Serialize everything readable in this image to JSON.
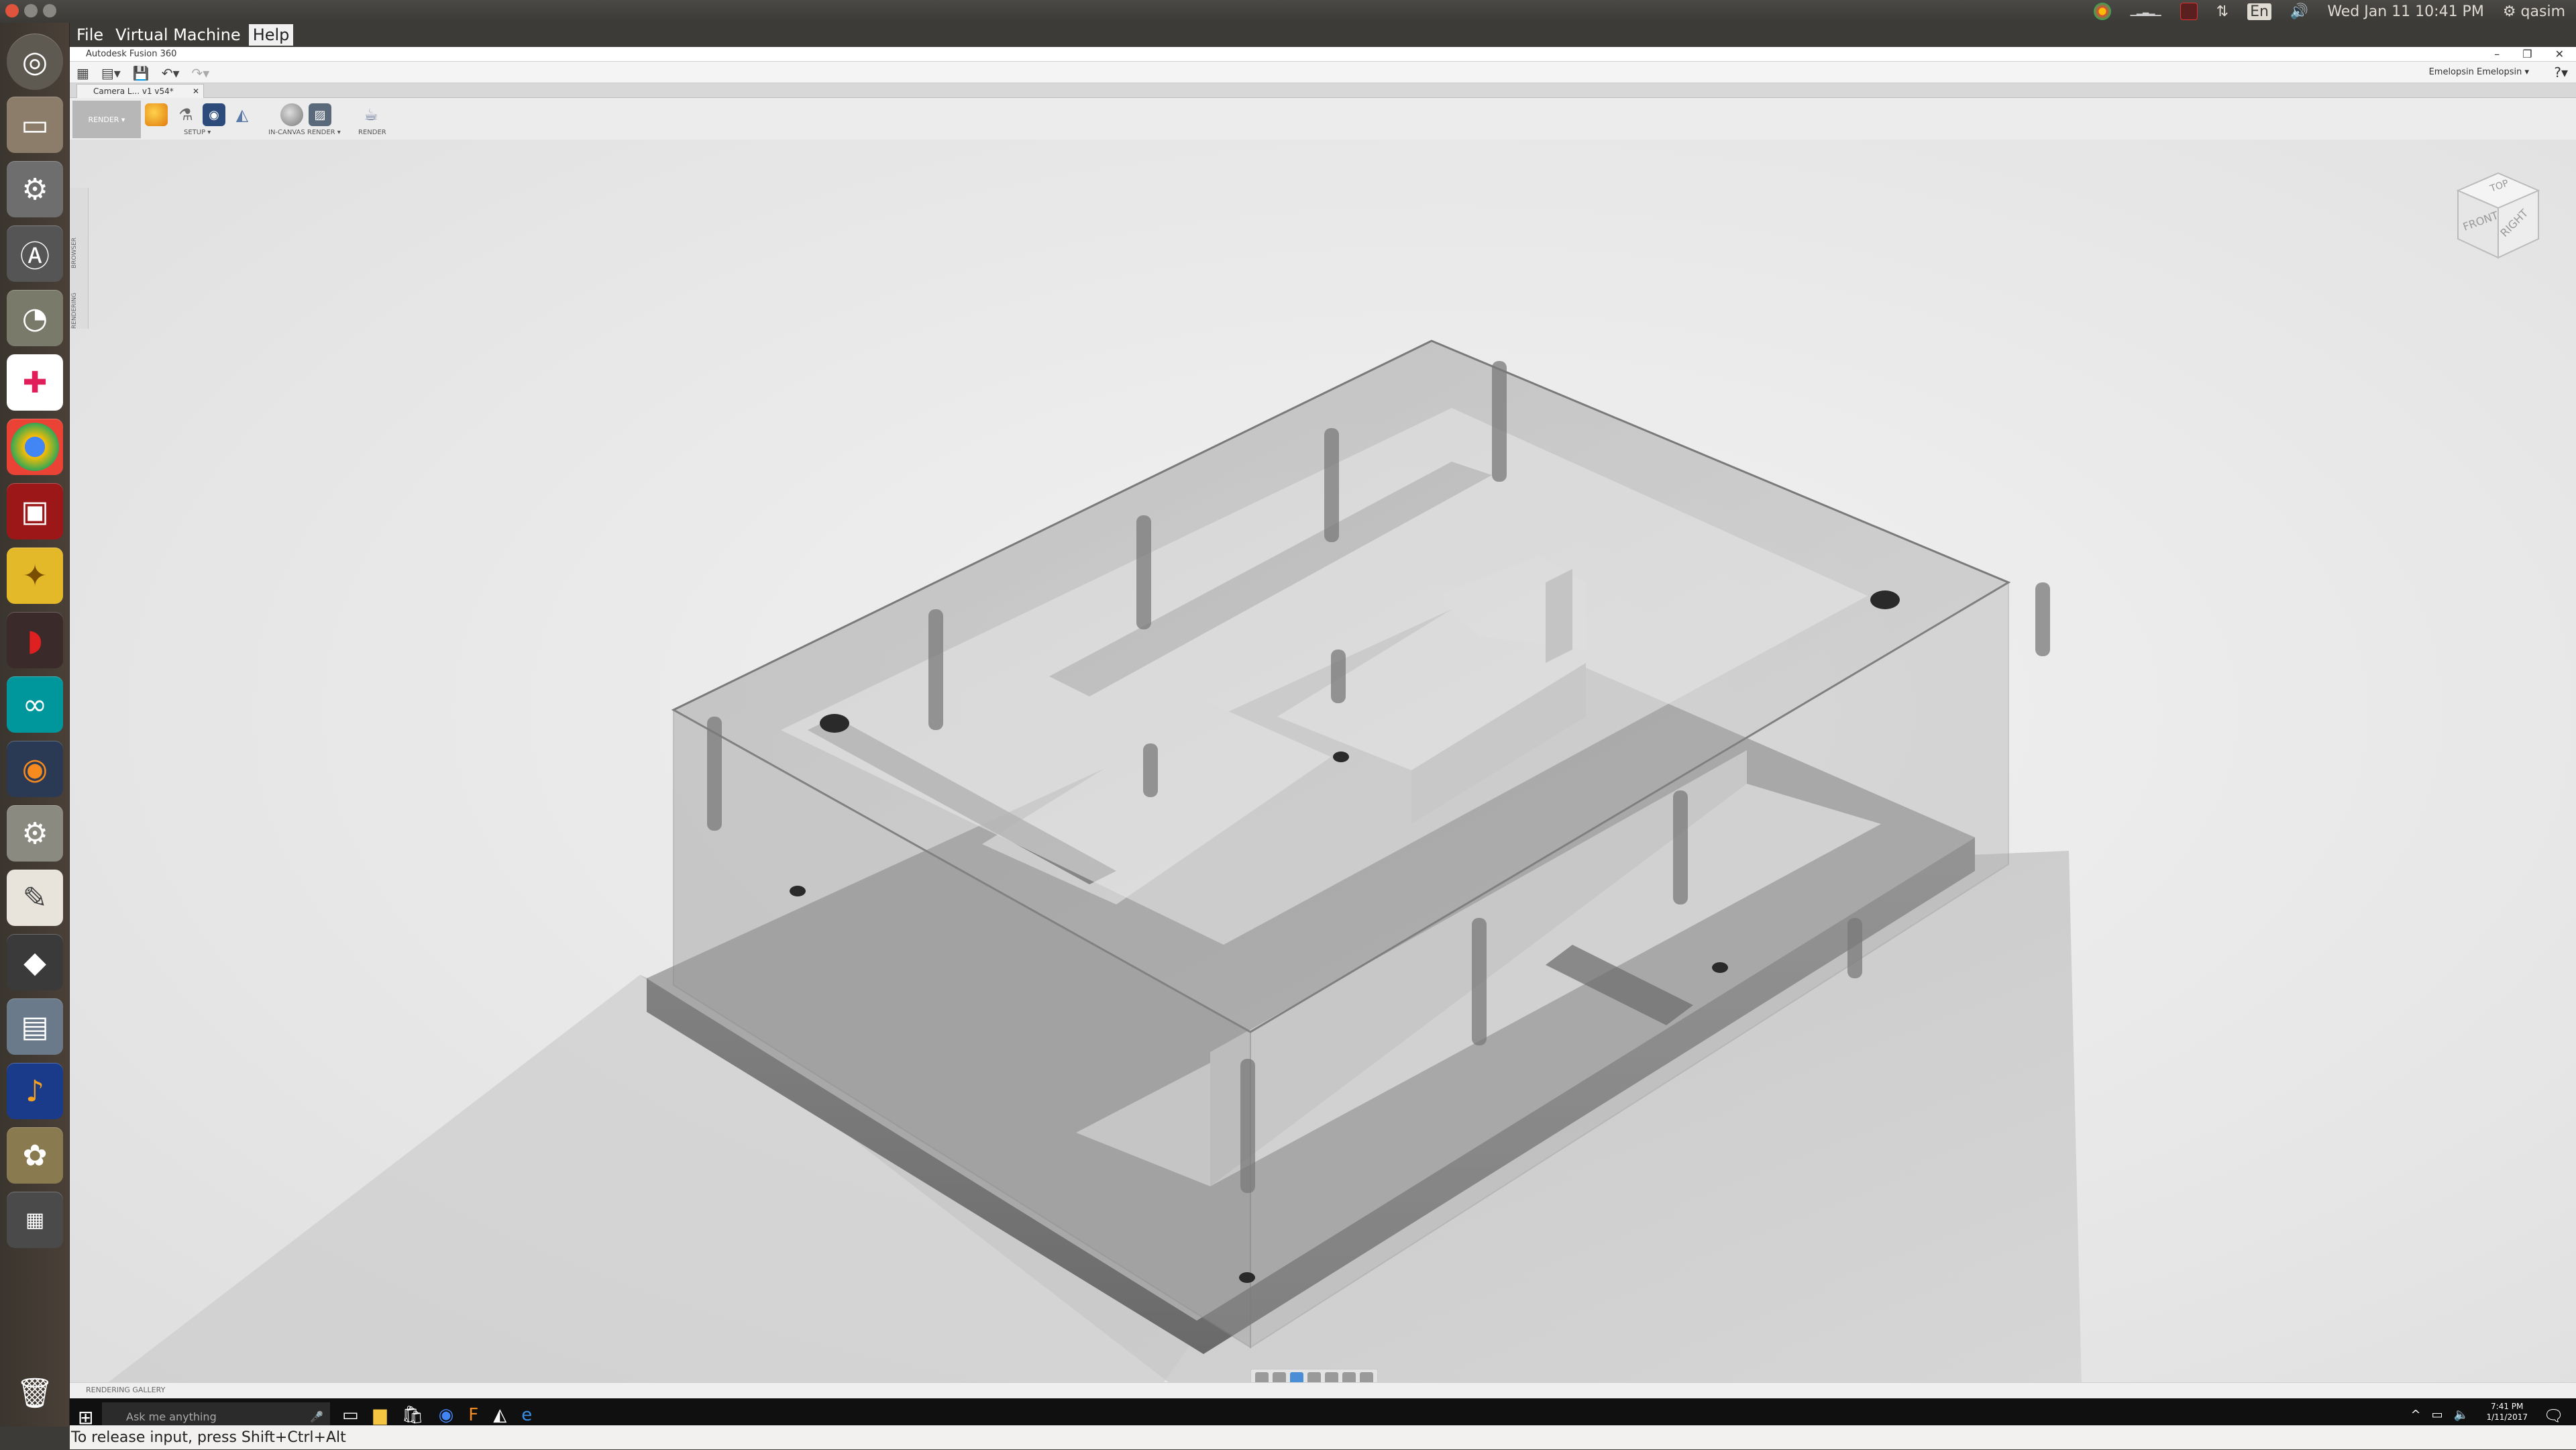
{
  "topbar": {
    "keyboard_layout": "En",
    "clock": "Wed Jan 11 10:41 PM",
    "user": "qasim"
  },
  "launcher": {
    "items": [
      "dash-home",
      "files",
      "system-settings",
      "software-updater",
      "disk-usage",
      "slack",
      "chrome",
      "terminal-app",
      "puzzle-app",
      "red-app",
      "arduino",
      "blender",
      "gears-app",
      "text-editor",
      "inkscape",
      "remote-desktop",
      "audacity",
      "gimp",
      "workspace-switcher",
      "trash"
    ]
  },
  "vm_menu": {
    "file": "File",
    "machine": "Virtual Machine",
    "help": "Help"
  },
  "fusion": {
    "title": "Autodesk Fusion 360",
    "user_menu": "Emelopsin Emelopsin ▾",
    "tab_label": "Camera L... v1 v54*",
    "workspace": "RENDER ▾",
    "toolbar": {
      "setup_label": "SETUP ▾",
      "in_canvas_label": "IN-CANVAS RENDER ▾",
      "render_label": "RENDER"
    },
    "browser_labels": [
      "BROWSER",
      "RENDERING"
    ],
    "viewcube": {
      "top": "TOP",
      "front": "FRONT",
      "right": "RIGHT"
    },
    "gallery_label": "RENDERING GALLERY"
  },
  "taskbar": {
    "search_placeholder": "Ask me anything",
    "time": "7:41 PM",
    "date": "1/11/2017"
  },
  "vm_status": "To release input, press Shift+Ctrl+Alt"
}
